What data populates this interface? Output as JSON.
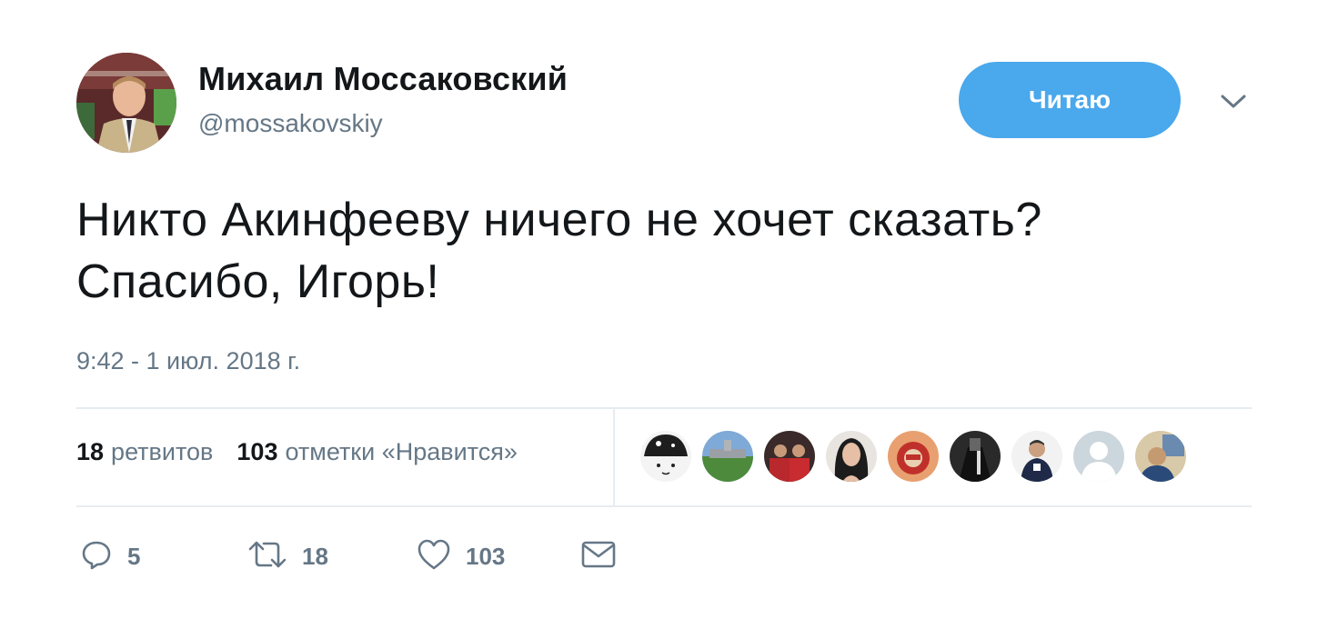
{
  "author": {
    "name": "Михаил Моссаковский",
    "handle": "@mossakovskiy"
  },
  "follow_button": {
    "label": "Читаю"
  },
  "tweet": {
    "text_line1": "Никто Акинфееву ничего не хочет сказать?",
    "text_line2": "Спасибо, Игорь!",
    "timestamp": "9:42 - 1 июл. 2018 г."
  },
  "stats": {
    "retweets_count": "18",
    "retweets_label": "ретвитов",
    "likes_count": "103",
    "likes_label": "отметки «Нравится»"
  },
  "liker_avatars": 9,
  "actions": {
    "reply_count": "5",
    "retweet_count": "18",
    "like_count": "103"
  },
  "colors": {
    "accent": "#4aa8ec",
    "text": "#14171a",
    "secondary": "#657786",
    "divider": "#e6ecf0"
  },
  "icons": [
    "chevron-down-icon",
    "reply-icon",
    "retweet-icon",
    "heart-icon",
    "mail-icon"
  ]
}
